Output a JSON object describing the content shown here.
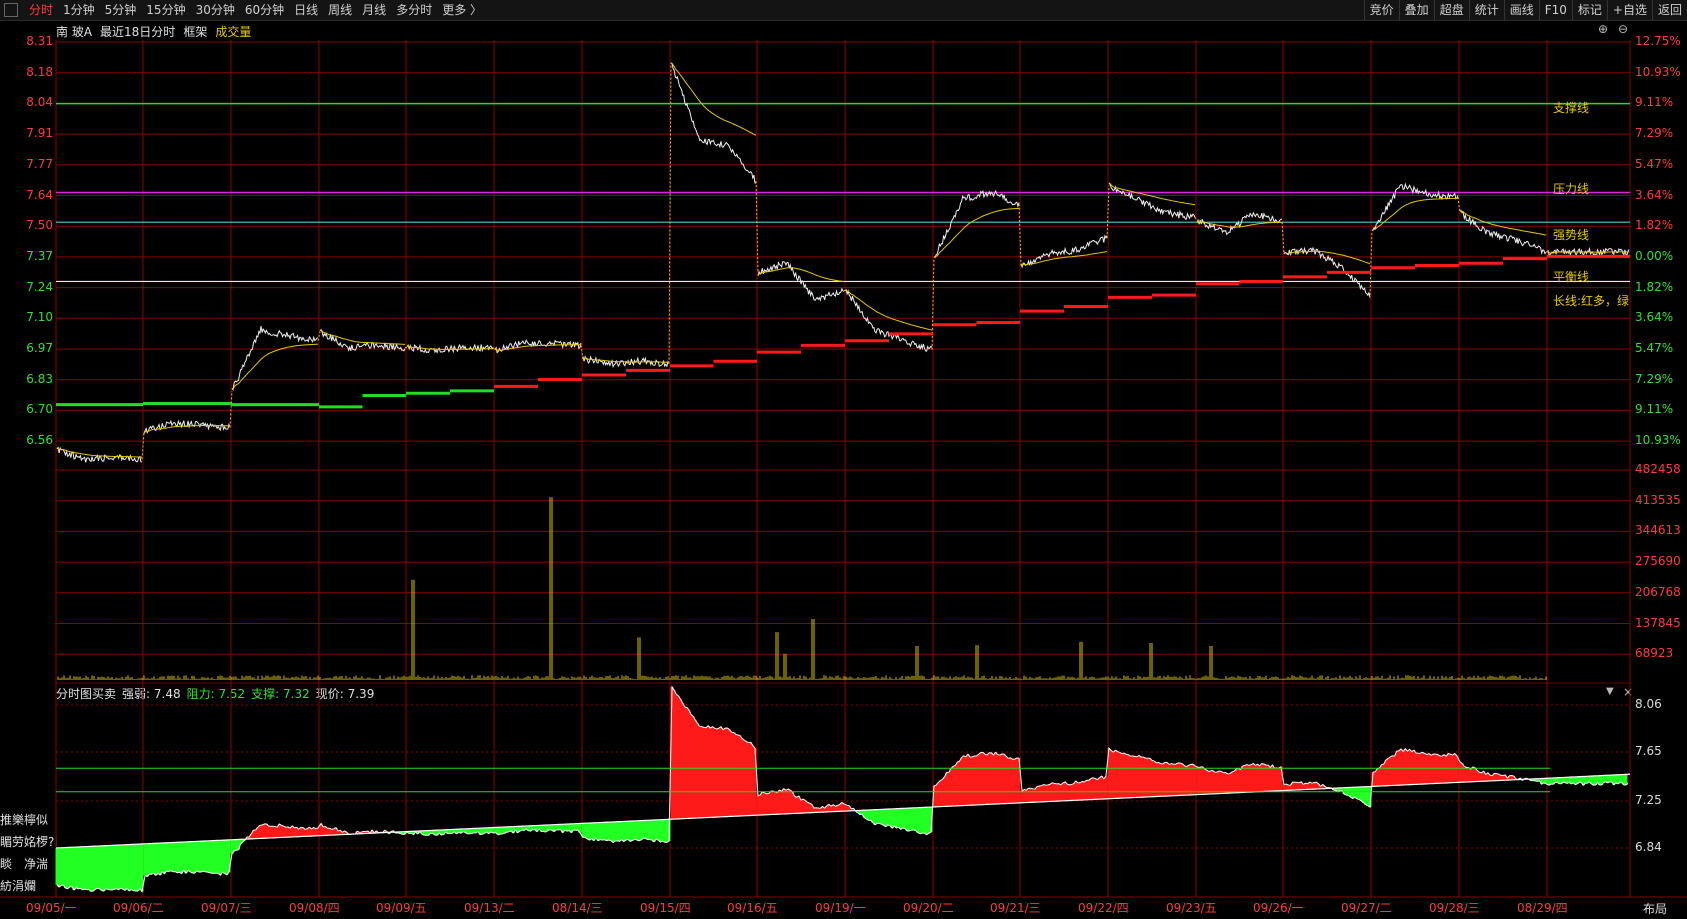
{
  "toolbar": {
    "left_items": [
      "分时",
      "1分钟",
      "5分钟",
      "15分钟",
      "30分钟",
      "60分钟",
      "日线",
      "周线",
      "月线",
      "多分时",
      "更多 〉"
    ],
    "active_index": 0,
    "right_items": [
      "竞价",
      "叠加",
      "超盘",
      "统计",
      "画线",
      "F10",
      "标记",
      "+自选",
      "返回"
    ]
  },
  "header": {
    "stock": "南 玻A",
    "range": "最近18日分时",
    "frame": "框架",
    "indicator": "成交量"
  },
  "price_axis": [
    "8.31",
    "8.18",
    "8.04",
    "7.91",
    "7.77",
    "7.64",
    "7.50",
    "7.37",
    "7.24",
    "7.10",
    "6.97",
    "6.83",
    "6.70",
    "6.56"
  ],
  "pct_axis": [
    "12.75%",
    "10.93%",
    "9.11%",
    "7.29%",
    "5.47%",
    "3.64%",
    "1.82%",
    "0.00%",
    "1.82%",
    "3.64%",
    "5.47%",
    "7.29%",
    "9.11%",
    "10.93%"
  ],
  "volume_axis": [
    "482458",
    "413535",
    "344613",
    "275690",
    "206768",
    "137845",
    "68923"
  ],
  "line_labels": {
    "support": "支撑线",
    "pressure": "压力线",
    "strong": "强势线",
    "balance": "平衡线",
    "longline": "长线:红多，绿空"
  },
  "sub_panel": {
    "title": "分时图买卖",
    "strong_label": "强弱: 7.48",
    "resist_label": "阻力: 7.52",
    "support_label": "支撑: 7.32",
    "price_label": "现价: 7.39",
    "axis": [
      "8.06",
      "7.65",
      "7.25",
      "6.84"
    ],
    "side_texts": [
      "推樂檸似",
      "睸劳姳椤?i",
      "睒　净湍",
      "紡涓孄"
    ]
  },
  "dates": [
    "09/05/一",
    "09/06/二",
    "09/07/三",
    "09/08/四",
    "09/09/五",
    "09/13/二",
    "08/14/三",
    "09/15/四",
    "09/16/五",
    "09/19/一",
    "09/20/二",
    "09/21/三",
    "09/22/四",
    "09/23/五",
    "09/26/一",
    "09/27/二",
    "09/28/三",
    "08/29/四"
  ],
  "corner_label": "布局",
  "colors": {
    "grid": "#8b0000",
    "axis_red": "#ff3b3b",
    "axis_green": "#30e030",
    "support": "#1ee01e",
    "pressure": "#e01ee0",
    "strong": "#4ad0d0",
    "balance": "#e8e8e8",
    "avg": "#e6c800",
    "volume": "#d8c000"
  },
  "chart_data": {
    "type": "line",
    "ylim": [
      6.43,
      8.31
    ],
    "support_value": 8.04,
    "pressure_value": 7.65,
    "strong_value": 7.52,
    "balance_value": 7.26,
    "day_segments": [
      [
        6.52,
        6.48,
        6.49,
        6.48
      ],
      [
        6.6,
        6.64,
        6.63,
        6.62
      ],
      [
        6.78,
        7.05,
        7.02,
        7.0
      ],
      [
        7.04,
        6.97,
        6.98,
        6.97
      ],
      [
        6.97,
        6.96,
        6.97,
        6.97
      ],
      [
        6.96,
        6.99,
        6.99,
        6.98
      ],
      [
        6.92,
        6.9,
        6.91,
        6.9
      ],
      [
        8.22,
        7.88,
        7.86,
        7.7
      ],
      [
        7.3,
        7.34,
        7.18,
        7.22
      ],
      [
        7.22,
        7.05,
        7.0,
        6.96
      ],
      [
        7.36,
        7.62,
        7.65,
        7.6
      ],
      [
        7.33,
        7.38,
        7.4,
        7.45
      ],
      [
        7.68,
        7.62,
        7.56,
        7.54
      ],
      [
        7.53,
        7.47,
        7.56,
        7.52
      ],
      [
        7.38,
        7.4,
        7.32,
        7.2
      ],
      [
        7.48,
        7.68,
        7.64,
        7.63
      ],
      [
        7.56,
        7.47,
        7.44,
        7.39
      ],
      [
        7.39,
        7.39,
        7.39,
        7.39
      ]
    ],
    "long_line": [
      6.72,
      6.72,
      6.725,
      6.725,
      6.72,
      6.72,
      6.71,
      6.76,
      6.77,
      6.78,
      6.8,
      6.83,
      6.85,
      6.87,
      6.89,
      6.91,
      6.95,
      6.98,
      7.0,
      7.03,
      7.07,
      7.08,
      7.13,
      7.15,
      7.19,
      7.2,
      7.25,
      7.26,
      7.28,
      7.3,
      7.32,
      7.33,
      7.34,
      7.36,
      7.37,
      7.37
    ],
    "volume_peaks": [
      {
        "x": 41,
        "v": 230000
      },
      {
        "x": 57,
        "v": 420000
      },
      {
        "x": 67,
        "v": 98000
      },
      {
        "x": 83,
        "v": 110000
      },
      {
        "x": 84,
        "v": 60000
      },
      {
        "x": 87,
        "v": 140000
      },
      {
        "x": 99,
        "v": 78000
      },
      {
        "x": 106,
        "v": 80000
      },
      {
        "x": 118,
        "v": 88000
      },
      {
        "x": 126,
        "v": 85000
      },
      {
        "x": 133,
        "v": 78000
      }
    ]
  }
}
